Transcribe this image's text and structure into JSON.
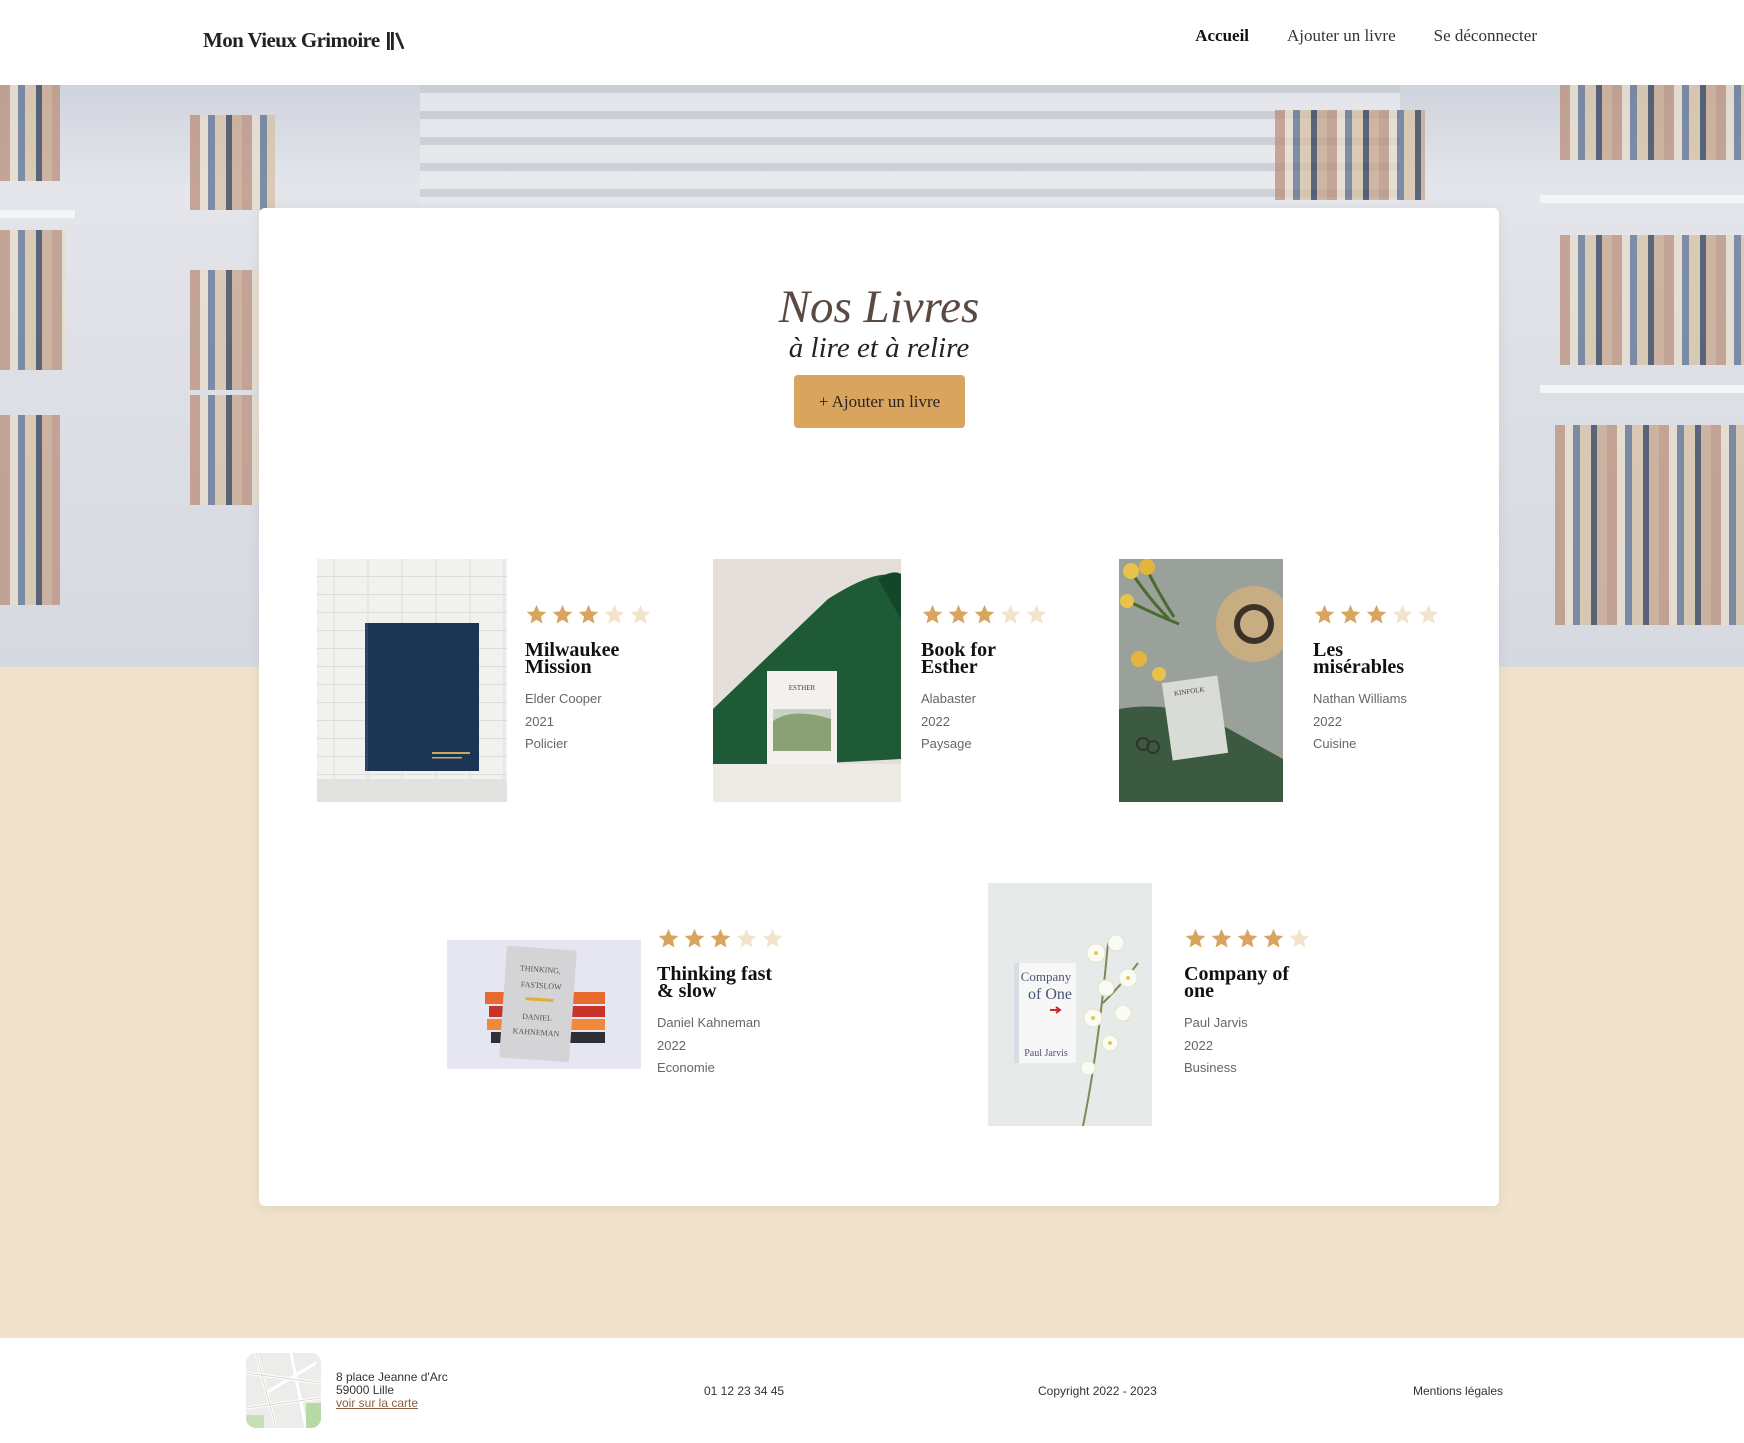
{
  "header": {
    "logo": "Mon Vieux Grimoire",
    "nav": [
      {
        "label": "Accueil",
        "active": true
      },
      {
        "label": "Ajouter un livre",
        "active": false
      },
      {
        "label": "Se déconnecter",
        "active": false
      }
    ]
  },
  "main": {
    "title": "Nos Livres",
    "subtitle": "à lire et à relire",
    "add_button": "+ Ajouter un livre"
  },
  "books": [
    {
      "title": "Milwaukee Mission",
      "author": "Elder Cooper",
      "year": "2021",
      "genre": "Policier",
      "rating": 3
    },
    {
      "title": "Book for Esther",
      "author": "Alabaster",
      "year": "2022",
      "genre": "Paysage",
      "rating": 3
    },
    {
      "title": "Les misérables",
      "author": "Nathan Williams",
      "year": "2022",
      "genre": "Cuisine",
      "rating": 3
    },
    {
      "title": "Thinking fast & slow",
      "author": "Daniel Kahneman",
      "year": "2022",
      "genre": "Economie",
      "rating": 3
    },
    {
      "title": "Company of one",
      "author": "Paul Jarvis",
      "year": "2022",
      "genre": "Business",
      "rating": 4
    }
  ],
  "cover_text": {
    "esther": "ESTHER",
    "thinking": [
      "THINKING,",
      "FAST",
      "SLOW",
      "DANIEL",
      "KAHNEMAN"
    ],
    "company": [
      "Company",
      "of One",
      "Paul Jarvis"
    ],
    "kinfolk": "KINFOLK"
  },
  "footer": {
    "address_line1": "8 place Jeanne d'Arc",
    "address_line2": "59000 Lille",
    "map_link": "voir sur la carte",
    "phone": "01 12 23 34 45",
    "copyright": "Copyright 2022 - 2023",
    "legal": "Mentions légales"
  },
  "colors": {
    "accent": "#d8a45e",
    "star_filled": "#d8a45e",
    "star_empty": "#f3e3cc",
    "page_bg": "#f0e2cc"
  }
}
